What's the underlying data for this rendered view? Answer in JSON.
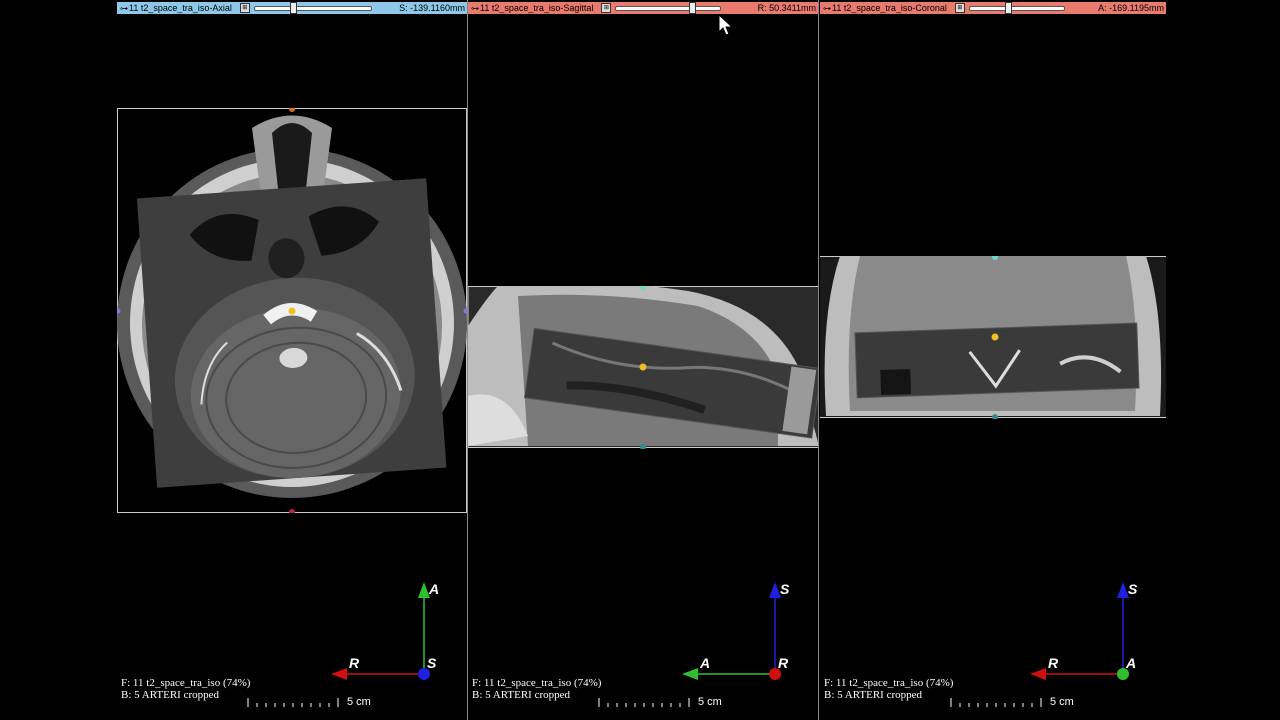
{
  "panes": [
    {
      "id": "axial",
      "title": "11 t2_space_tra_iso-Axial",
      "coord": "S: -139.1160mm",
      "title_color": "#8ec8e8",
      "slider_pos": 0.6,
      "fg_label": "F: 11 t2_space_tra_iso (74%)",
      "bg_label": "B: 5 ARTERI cropped",
      "scale_label": "5 cm",
      "axis_vertical": "A",
      "axis_horizontal": "R",
      "axis_center": "S",
      "axis_v_color": "#2ec02e",
      "axis_h_color": "#d01010",
      "axis_c_color": "#2020e0"
    },
    {
      "id": "sagittal",
      "title": "11 t2_space_tra_iso-Sagittal",
      "coord": "R: 50.3411mm",
      "title_color": "#e87a6e",
      "slider_pos": 0.72,
      "fg_label": "F: 11 t2_space_tra_iso (74%)",
      "bg_label": "B: 5 ARTERI cropped",
      "scale_label": "5 cm",
      "axis_vertical": "S",
      "axis_horizontal": "A",
      "axis_center": "R",
      "axis_v_color": "#2020e0",
      "axis_h_color": "#2ec02e",
      "axis_c_color": "#d01010"
    },
    {
      "id": "coronal",
      "title": "11 t2_space_tra_iso-Coronal",
      "coord": "A: -169.1195mm",
      "title_color": "#e87a6e",
      "slider_pos": 0.4,
      "fg_label": "F: 11 t2_space_tra_iso (74%)",
      "bg_label": "B: 5 ARTERI cropped",
      "scale_label": "5 cm",
      "axis_vertical": "S",
      "axis_horizontal": "R",
      "axis_center": "A",
      "axis_v_color": "#2020e0",
      "axis_h_color": "#d01010",
      "axis_c_color": "#2ec02e"
    }
  ],
  "icons": {
    "pin": "pin-icon",
    "link": "link-icon",
    "cursor": "mouse-pointer-icon"
  }
}
